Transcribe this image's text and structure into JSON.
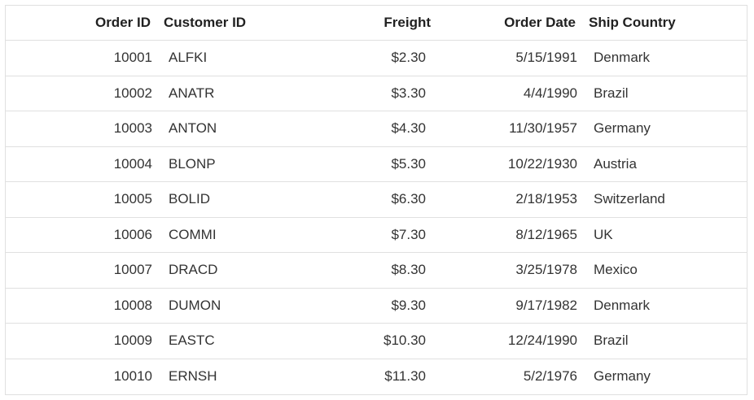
{
  "columns": {
    "order_id": "Order ID",
    "customer_id": "Customer ID",
    "freight": "Freight",
    "order_date": "Order Date",
    "ship_country": "Ship Country"
  },
  "rows": [
    {
      "order_id": "10001",
      "customer_id": "ALFKI",
      "freight": "$2.30",
      "order_date": "5/15/1991",
      "ship_country": "Denmark"
    },
    {
      "order_id": "10002",
      "customer_id": "ANATR",
      "freight": "$3.30",
      "order_date": "4/4/1990",
      "ship_country": "Brazil"
    },
    {
      "order_id": "10003",
      "customer_id": "ANTON",
      "freight": "$4.30",
      "order_date": "11/30/1957",
      "ship_country": "Germany"
    },
    {
      "order_id": "10004",
      "customer_id": "BLONP",
      "freight": "$5.30",
      "order_date": "10/22/1930",
      "ship_country": "Austria"
    },
    {
      "order_id": "10005",
      "customer_id": "BOLID",
      "freight": "$6.30",
      "order_date": "2/18/1953",
      "ship_country": "Switzerland"
    },
    {
      "order_id": "10006",
      "customer_id": "COMMI",
      "freight": "$7.30",
      "order_date": "8/12/1965",
      "ship_country": "UK"
    },
    {
      "order_id": "10007",
      "customer_id": "DRACD",
      "freight": "$8.30",
      "order_date": "3/25/1978",
      "ship_country": "Mexico"
    },
    {
      "order_id": "10008",
      "customer_id": "DUMON",
      "freight": "$9.30",
      "order_date": "9/17/1982",
      "ship_country": "Denmark"
    },
    {
      "order_id": "10009",
      "customer_id": "EASTC",
      "freight": "$10.30",
      "order_date": "12/24/1990",
      "ship_country": "Brazil"
    },
    {
      "order_id": "10010",
      "customer_id": "ERNSH",
      "freight": "$11.30",
      "order_date": "5/2/1976",
      "ship_country": "Germany"
    }
  ]
}
